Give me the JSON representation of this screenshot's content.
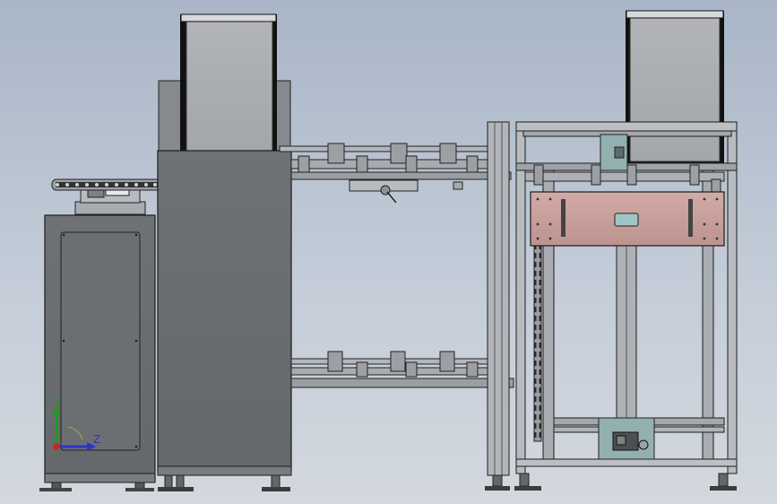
{
  "viewport": {
    "background_top": "#a9b6c7",
    "background_bottom": "#d3d8de"
  },
  "colors": {
    "steel_light": "#b4b8bc",
    "steel_mid": "#8c9095",
    "cabinet_dark": "#6a6d70",
    "outline": "#1c1c1c",
    "carriage_pink": "#c9a09d",
    "bracket_teal": "#93b0b0",
    "axis_y": "#1e9a1e",
    "axis_z": "#2a35c8",
    "axis_x": "#d02020"
  },
  "triad": {
    "y_label": "Y",
    "z_label": "Z"
  }
}
